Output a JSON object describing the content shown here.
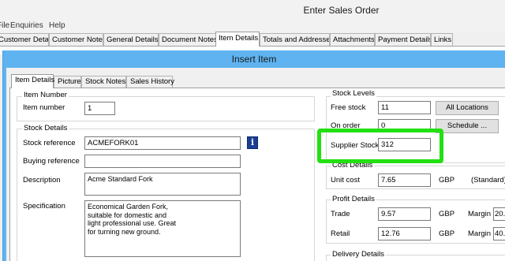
{
  "parent_window": {
    "title": "Enter Sales Order",
    "menu": [
      "File",
      "Enquiries",
      "Help"
    ],
    "tabs": [
      "Customer Details",
      "Customer Notes",
      "General Details",
      "Document Notes",
      "Item Details",
      "Totals and Addresses",
      "Attachments",
      "Payment Details",
      "Links"
    ],
    "active_tab": "Item Details"
  },
  "dialog": {
    "title": "Insert Item",
    "tabs": [
      "Item Details",
      "Picture",
      "Stock Notes",
      "Sales History"
    ],
    "active_tab": "Item Details"
  },
  "item_number_group": {
    "title": "Item Number",
    "label": "Item number",
    "value": "1"
  },
  "stock_details_group": {
    "title": "Stock Details",
    "stock_reference_label": "Stock reference",
    "stock_reference_value": "ACMEFORK01",
    "buying_reference_label": "Buying reference",
    "buying_reference_value": "",
    "description_label": "Description",
    "description_value": "Acme Standard Fork",
    "specification_label": "Specification",
    "specification_value": "Economical Garden Fork,\nsuitable for domestic and\nlight professional use. Great\nfor turning new ground."
  },
  "stock_levels_group": {
    "title": "Stock Levels",
    "free_stock_label": "Free stock",
    "free_stock_value": "11",
    "on_order_label": "On order",
    "on_order_value": "0",
    "supplier_stock_label": "Supplier Stock",
    "supplier_stock_value": "312",
    "all_locations_button": "All Locations",
    "schedule_button": "Schedule ..."
  },
  "cost_details_group": {
    "title": "Cost Details",
    "unit_cost_label": "Unit cost",
    "unit_cost_value": "7.65",
    "currency": "GBP",
    "cost_type": "(Standard)"
  },
  "profit_details_group": {
    "title": "Profit Details",
    "trade_label": "Trade",
    "trade_value": "9.57",
    "trade_currency": "GBP",
    "trade_margin_label": "Margin",
    "trade_margin_value": "20.",
    "retail_label": "Retail",
    "retail_value": "12.76",
    "retail_currency": "GBP",
    "retail_margin_label": "Margin",
    "retail_margin_value": "40."
  },
  "delivery_details_group": {
    "title": "Delivery Details"
  },
  "colors": {
    "dialog_frame": "#5fb3f0",
    "highlight": "#22e012",
    "info_icon": "#1c3f95"
  }
}
